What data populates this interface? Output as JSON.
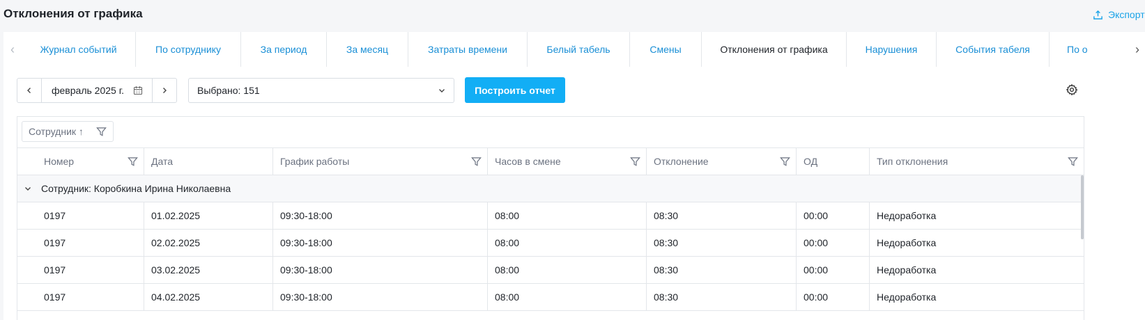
{
  "header": {
    "title": "Отклонения от графика",
    "export_label": "Экспорт"
  },
  "tabs": [
    {
      "label": "Журнал событий",
      "active": false
    },
    {
      "label": "По сотруднику",
      "active": false
    },
    {
      "label": "За период",
      "active": false
    },
    {
      "label": "За месяц",
      "active": false
    },
    {
      "label": "Затраты времени",
      "active": false
    },
    {
      "label": "Белый табель",
      "active": false
    },
    {
      "label": "Смены",
      "active": false
    },
    {
      "label": "Отклонения от графика",
      "active": true
    },
    {
      "label": "Нарушения",
      "active": false
    },
    {
      "label": "События табеля",
      "active": false
    },
    {
      "label": "По о",
      "active": false
    }
  ],
  "toolbar": {
    "period_value": "февраль 2025 г.",
    "selection_value": "Выбрано: 151",
    "build_label": "Построить отчет"
  },
  "grouping": {
    "chip_label": "Сотрудник ↑"
  },
  "table": {
    "columns": [
      "Номер",
      "Дата",
      "График работы",
      "Часов в смене",
      "Отклонение",
      "ОД",
      "Тип отклонения"
    ],
    "group_label": "Сотрудник: Коробкина Ирина Николаевна",
    "rows": [
      [
        "0197",
        "01.02.2025",
        "09:30-18:00",
        "08:00",
        "08:30",
        "00:00",
        "Недоработка"
      ],
      [
        "0197",
        "02.02.2025",
        "09:30-18:00",
        "08:00",
        "08:30",
        "00:00",
        "Недоработка"
      ],
      [
        "0197",
        "03.02.2025",
        "09:30-18:00",
        "08:00",
        "08:30",
        "00:00",
        "Недоработка"
      ],
      [
        "0197",
        "04.02.2025",
        "09:30-18:00",
        "08:00",
        "08:30",
        "00:00",
        "Недоработка"
      ]
    ]
  },
  "colors": {
    "accent": "#12aef5",
    "link": "#1a8fd6"
  }
}
